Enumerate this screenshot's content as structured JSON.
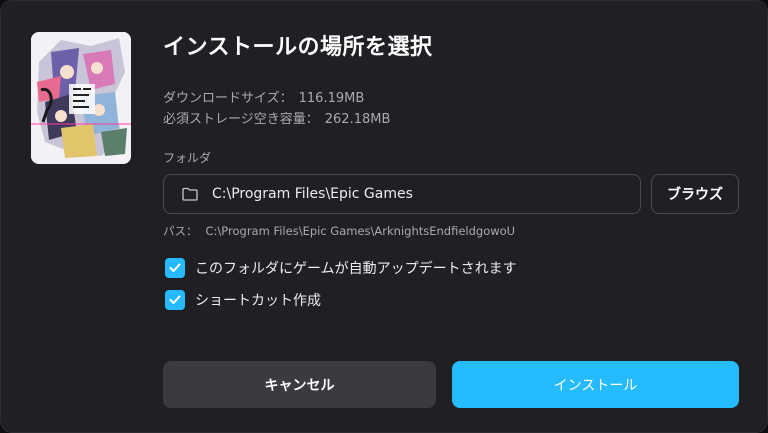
{
  "dialog": {
    "title": "インストールの場所を選択",
    "download_size_label": "ダウンロードサイズ：",
    "download_size_value": "116.19MB",
    "required_space_label": "必須ストレージ空き容量：",
    "required_space_value": "262.18MB"
  },
  "folder": {
    "label": "フォルダ",
    "value": "C:\\Program Files\\Epic Games",
    "icon": "folder-icon",
    "browse_label": "ブラウズ"
  },
  "path": {
    "label": "パス：",
    "value": "C:\\Program Files\\Epic Games\\ArknightsEndfieldgowoU"
  },
  "options": [
    {
      "label": "このフォルダにゲームが自動アップデートされます",
      "checked": true
    },
    {
      "label": "ショートカット作成",
      "checked": true
    }
  ],
  "actions": {
    "cancel_label": "キャンセル",
    "install_label": "インストール"
  },
  "colors": {
    "accent": "#26bbff",
    "background": "#202024",
    "secondary_button": "#3a3a3f"
  }
}
